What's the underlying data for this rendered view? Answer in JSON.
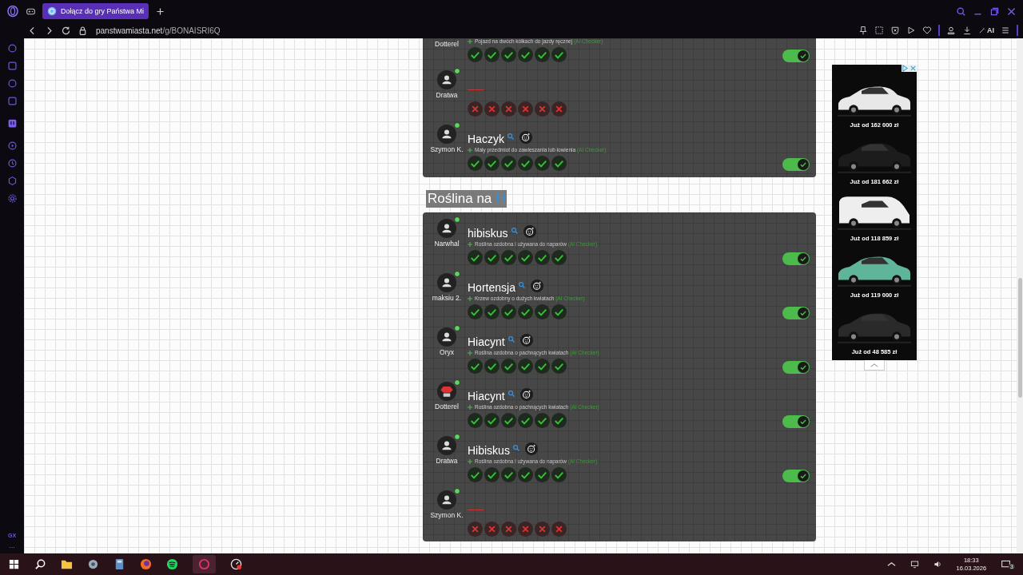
{
  "browser": {
    "tab_title": "Dołącz do gry Państwa Mi",
    "url_host": "panstwamiasta.net",
    "url_path": "/g/BONAISRI6Q",
    "ai_label": "AI"
  },
  "sidebar": {
    "brand": "GX",
    "more": "···"
  },
  "cards": [
    {
      "rows": [
        {
          "user": "Dotterel",
          "description": "Pojazd na dwóch kółkach do jazdy ręcznej",
          "checker": "(AI Checker)",
          "votes": [
            {
              "ok": true
            },
            {
              "ok": true
            },
            {
              "ok": true
            },
            {
              "ok": true
            },
            {
              "ok": true
            },
            {
              "ok": true
            }
          ],
          "accepted": true
        },
        {
          "user": "Dratwa",
          "avatar": {
            "kind": "default"
          },
          "online": true,
          "votes": [
            {
              "ok": false
            },
            {
              "ok": false
            },
            {
              "ok": false
            },
            {
              "ok": false
            },
            {
              "ok": false
            },
            {
              "ok": false
            }
          ],
          "accepted": false
        },
        {
          "user": "Szymon K.",
          "avatar": {
            "kind": "default"
          },
          "online": true,
          "word": "Haczyk",
          "description": "Mały przedmiot do zawieszania lub łowienia",
          "checker": "(AI Checker)",
          "votes": [
            {
              "ok": true
            },
            {
              "ok": true
            },
            {
              "ok": true
            },
            {
              "ok": true
            },
            {
              "ok": true
            },
            {
              "ok": true
            }
          ],
          "accepted": true
        }
      ]
    },
    {
      "title": "Roślina na",
      "letter": "H",
      "rows": [
        {
          "user": "Narwhal",
          "avatar": {
            "kind": "default"
          },
          "online": true,
          "word": "hibiskus",
          "description": "Roślina ozdobna i używana do naparów",
          "checker": "(AI Checker)",
          "votes": [
            {
              "ok": true
            },
            {
              "ok": true
            },
            {
              "ok": true
            },
            {
              "ok": true
            },
            {
              "ok": true
            },
            {
              "ok": true
            }
          ],
          "accepted": true
        },
        {
          "user": "maksiu 2.",
          "avatar": {
            "kind": "default"
          },
          "online": true,
          "word": "Hortensja",
          "description": "Krzew ozdobny o dużych kwiatach",
          "checker": "(AI Checker)",
          "votes": [
            {
              "ok": true
            },
            {
              "ok": true
            },
            {
              "ok": true
            },
            {
              "ok": true
            },
            {
              "ok": true
            },
            {
              "ok": true
            }
          ],
          "accepted": true
        },
        {
          "user": "Oryx",
          "avatar": {
            "kind": "default"
          },
          "online": true,
          "word": "Hiacynt",
          "description": "Roślina ozdobna o pachnących kwiatach",
          "checker": "(AI Checker)",
          "votes": [
            {
              "ok": true
            },
            {
              "ok": true
            },
            {
              "ok": true
            },
            {
              "ok": true
            },
            {
              "ok": true
            },
            {
              "ok": true
            }
          ],
          "accepted": true
        },
        {
          "user": "Dotterel",
          "avatar": {
            "kind": "stop"
          },
          "online": true,
          "word": "Hiacynt",
          "description": "Roślina ozdobna o pachnących kwiatach",
          "checker": "(AI Checker)",
          "votes": [
            {
              "ok": true
            },
            {
              "ok": true
            },
            {
              "ok": true
            },
            {
              "ok": true
            },
            {
              "ok": true
            },
            {
              "ok": true
            }
          ],
          "accepted": true
        },
        {
          "user": "Dratwa",
          "avatar": {
            "kind": "default"
          },
          "online": true,
          "word": "Hibiskus",
          "description": "Roślina ozdobna i używana do naparów",
          "checker": "(AI Checker)",
          "votes": [
            {
              "ok": true
            },
            {
              "ok": true
            },
            {
              "ok": true
            },
            {
              "ok": true
            },
            {
              "ok": true
            },
            {
              "ok": true
            }
          ],
          "accepted": true
        },
        {
          "user": "Szymon K.",
          "avatar": {
            "kind": "default"
          },
          "online": true,
          "votes": [
            {
              "ok": false
            },
            {
              "ok": false
            },
            {
              "ok": false
            },
            {
              "ok": false
            },
            {
              "ok": false
            },
            {
              "ok": false
            }
          ],
          "accepted": false
        }
      ]
    }
  ],
  "ad": {
    "items": [
      {
        "kind": "picture",
        "price": "Już od 162 000 zł"
      },
      {
        "kind": "picture",
        "price": "Już od 181 662 zł"
      },
      {
        "kind": "picture",
        "price": "Już od 118 859 zł"
      },
      {
        "kind": "picture",
        "price": "Już od 119 000 zł"
      },
      {
        "kind": "picture",
        "price": "Już od 48 585 zł"
      }
    ]
  },
  "taskbar": {
    "time": "18:33",
    "date": "16.03.2026",
    "notifications": "3"
  }
}
